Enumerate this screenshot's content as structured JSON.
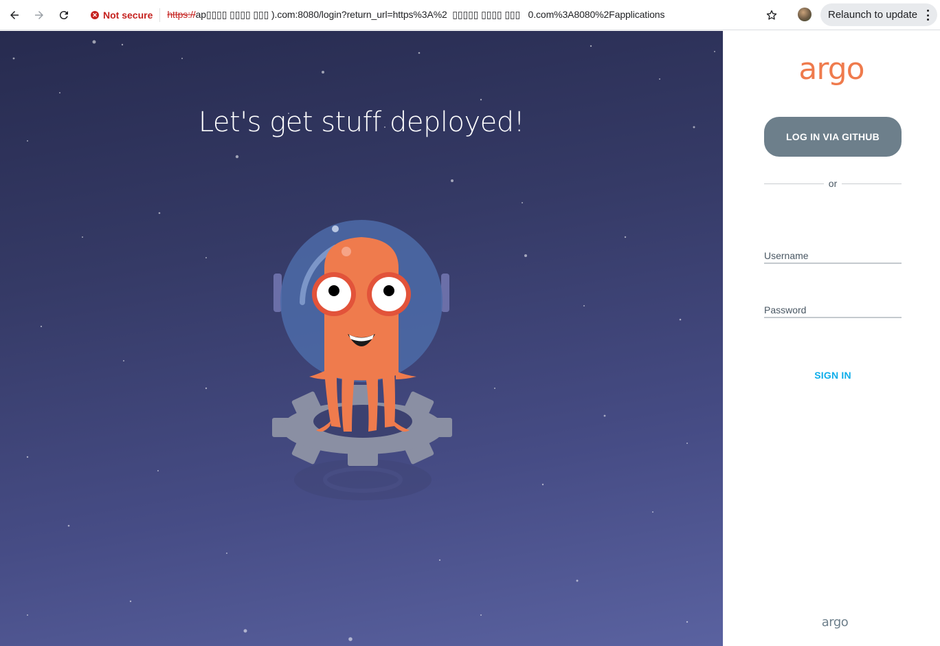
{
  "browser": {
    "security_label": "Not secure",
    "url_scheme": "https://",
    "url_host": "ap▯▯▯▯ ▯▯▯▯ ▯▯▯ ",
    "url_rest": ").com:8080/login?return_url=https%3A%2  ▯▯▯▯▯ ▯▯▯▯ ▯▯▯   0.com%3A8080%2Fapplications",
    "relaunch_label": "Relaunch to update"
  },
  "hero": {
    "title": "Let's get stuff deployed!"
  },
  "login": {
    "logo_text": "argo",
    "github_label": "LOG IN VIA GITHUB",
    "or_label": "or",
    "username_placeholder": "Username",
    "password_placeholder": "Password",
    "signin_label": "SIGN IN",
    "footer_logo": "argo"
  },
  "colors": {
    "brand_orange": "#ef7b4d",
    "github_button": "#6d7f8b",
    "signin_link": "#0dadea",
    "hero_bg_top": "#272b4f",
    "hero_bg_bottom": "#5a62a0"
  }
}
